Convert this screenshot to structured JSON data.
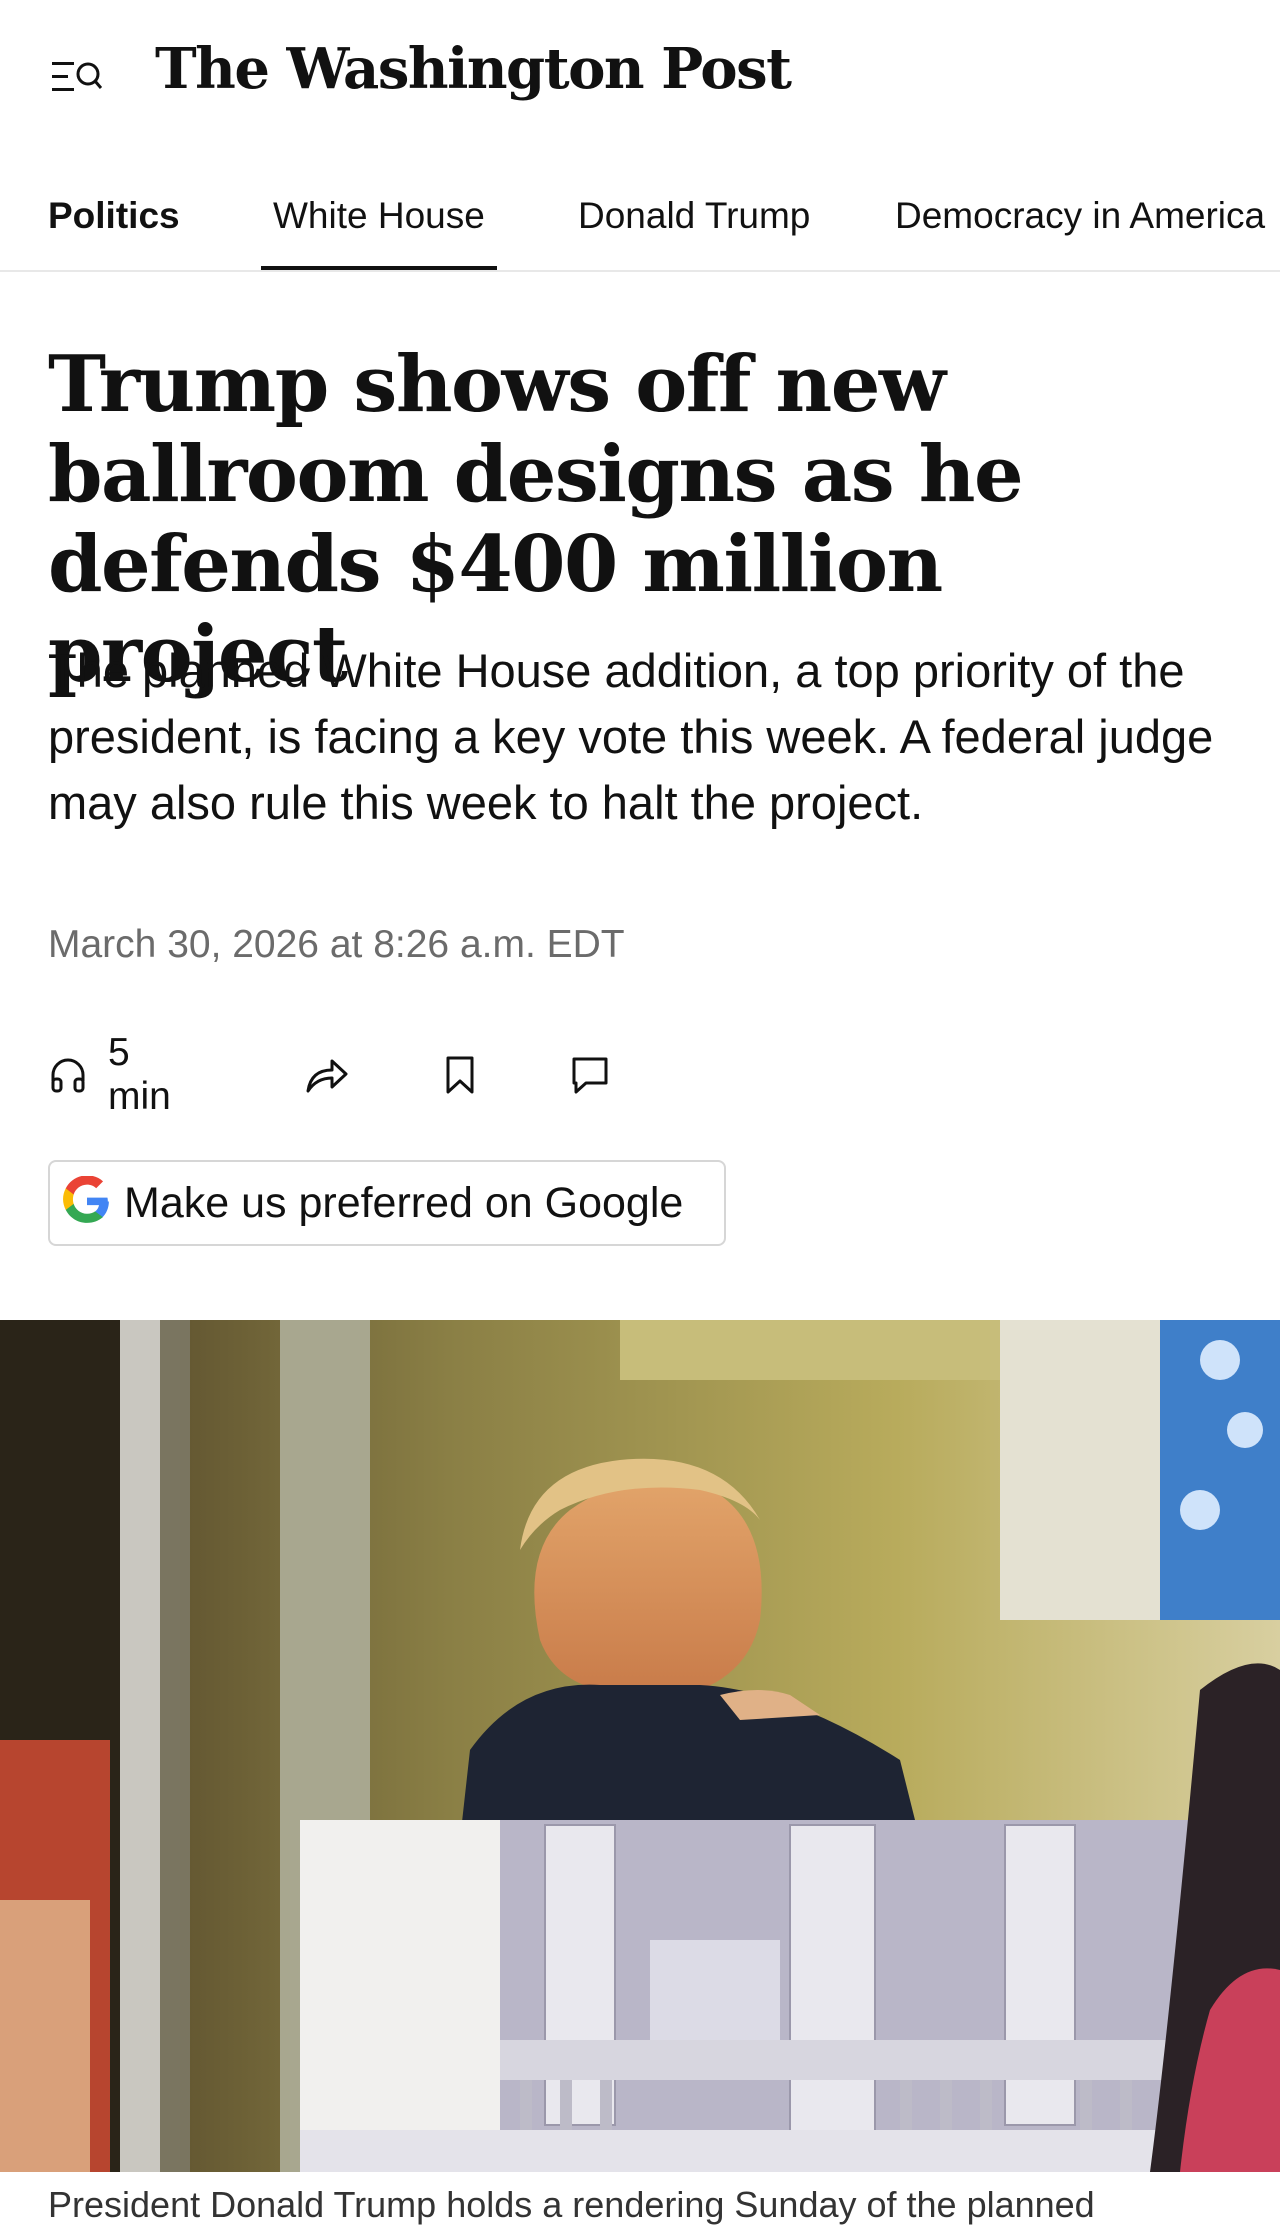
{
  "header": {
    "logo": "The Washington Post",
    "menu_icon": "menu-search-icon"
  },
  "nav": {
    "items": [
      {
        "label": "Politics",
        "bold": true
      },
      {
        "label": "White House",
        "active": true
      },
      {
        "label": "Donald Trump"
      },
      {
        "label": "Democracy in America"
      }
    ]
  },
  "article": {
    "headline": "Trump shows off new ballroom designs as he defends $400 million project",
    "dek": "The planned White House addition, a top priority of the president, is facing a key vote this week. A federal judge may also rule this week to halt the project.",
    "dateline": "March 30, 2026 at 8:26 a.m. EDT",
    "actions": {
      "listen_label": "5 min",
      "listen_icon": "headphones-icon",
      "share_icon": "share-icon",
      "save_icon": "bookmark-icon",
      "comment_icon": "comment-icon"
    },
    "google_button": {
      "label": "Make us preferred on Google",
      "icon": "google-g-icon"
    },
    "photo": {
      "description_icon": "lead-photo"
    },
    "caption": "President Donald Trump holds a rendering Sunday of the planned"
  },
  "colors": {
    "text": "#111111",
    "muted": "#6b6b6b",
    "divider": "#e8e8e8"
  }
}
